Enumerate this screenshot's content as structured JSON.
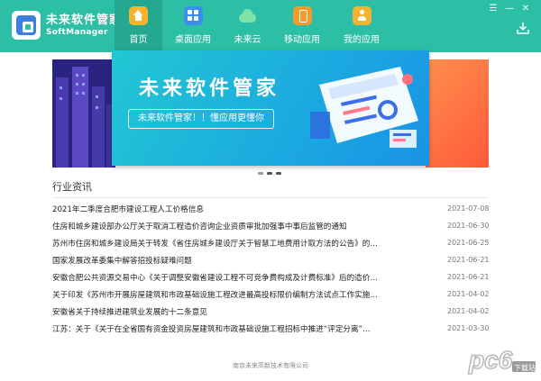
{
  "app": {
    "name_cn": "未来软件管家",
    "name_en": "SoftManager"
  },
  "nav": [
    {
      "label": "首页",
      "icon": "home-icon",
      "active": true
    },
    {
      "label": "桌面应用",
      "icon": "desktop-apps-icon",
      "active": false
    },
    {
      "label": "未来云",
      "icon": "cloud-icon",
      "active": false
    },
    {
      "label": "移动应用",
      "icon": "mobile-apps-icon",
      "active": false
    },
    {
      "label": "我的应用",
      "icon": "my-apps-icon",
      "active": false
    }
  ],
  "window_controls": {
    "menu": "☰",
    "minimize": "—",
    "close": "✕"
  },
  "banner": {
    "title": "未来软件管家",
    "subtitle": "未来软件管家！！懂应用更懂你",
    "active_slide": 1,
    "slide_count": 3
  },
  "news": {
    "title": "行业资讯",
    "items": [
      {
        "text": "2021年二季度合肥市建设工程人工价格信息",
        "date": "2021-07-08"
      },
      {
        "text": "住房和城乡建设部办公厅关于取消工程造价咨询企业资质审批加强事中事后监管的通知",
        "date": "2021-06-30"
      },
      {
        "text": "苏州市住房和城乡建设局关于转发《省住房城乡建设厅关于智慧工地费用计取方法的公告》的…",
        "date": "2021-06-25"
      },
      {
        "text": "国家发展改革委集中解答招投标疑难问题",
        "date": "2021-06-21"
      },
      {
        "text": "安徽合肥公共资源交易中心《关于调整安徽省建设工程不可竞争费构成及计费标准》后的造价…",
        "date": "2021-06-21"
      },
      {
        "text": "关于印发《苏州市开展房屋建筑和市政基础设施工程改进最高投标限价编制方法试点工作实施…",
        "date": "2021-04-02"
      },
      {
        "text": "安徽省关于持续推进建筑业发展的十二条意见",
        "date": "2021-04-02"
      },
      {
        "text": "江苏：关于《关于在全省国有资金投资房屋建筑和市政基础设施工程招标中推进“评定分离”…",
        "date": "2021-03-30"
      }
    ]
  },
  "footer": {
    "company": "南京未来高新技术有限公司"
  },
  "watermark": {
    "brand": "pc6",
    "tag": "下载站"
  },
  "colors": {
    "header": "#2dbfa5",
    "header_active": "#24a88f",
    "banner_start": "#22c7d3",
    "banner_end": "#1a93e6"
  }
}
